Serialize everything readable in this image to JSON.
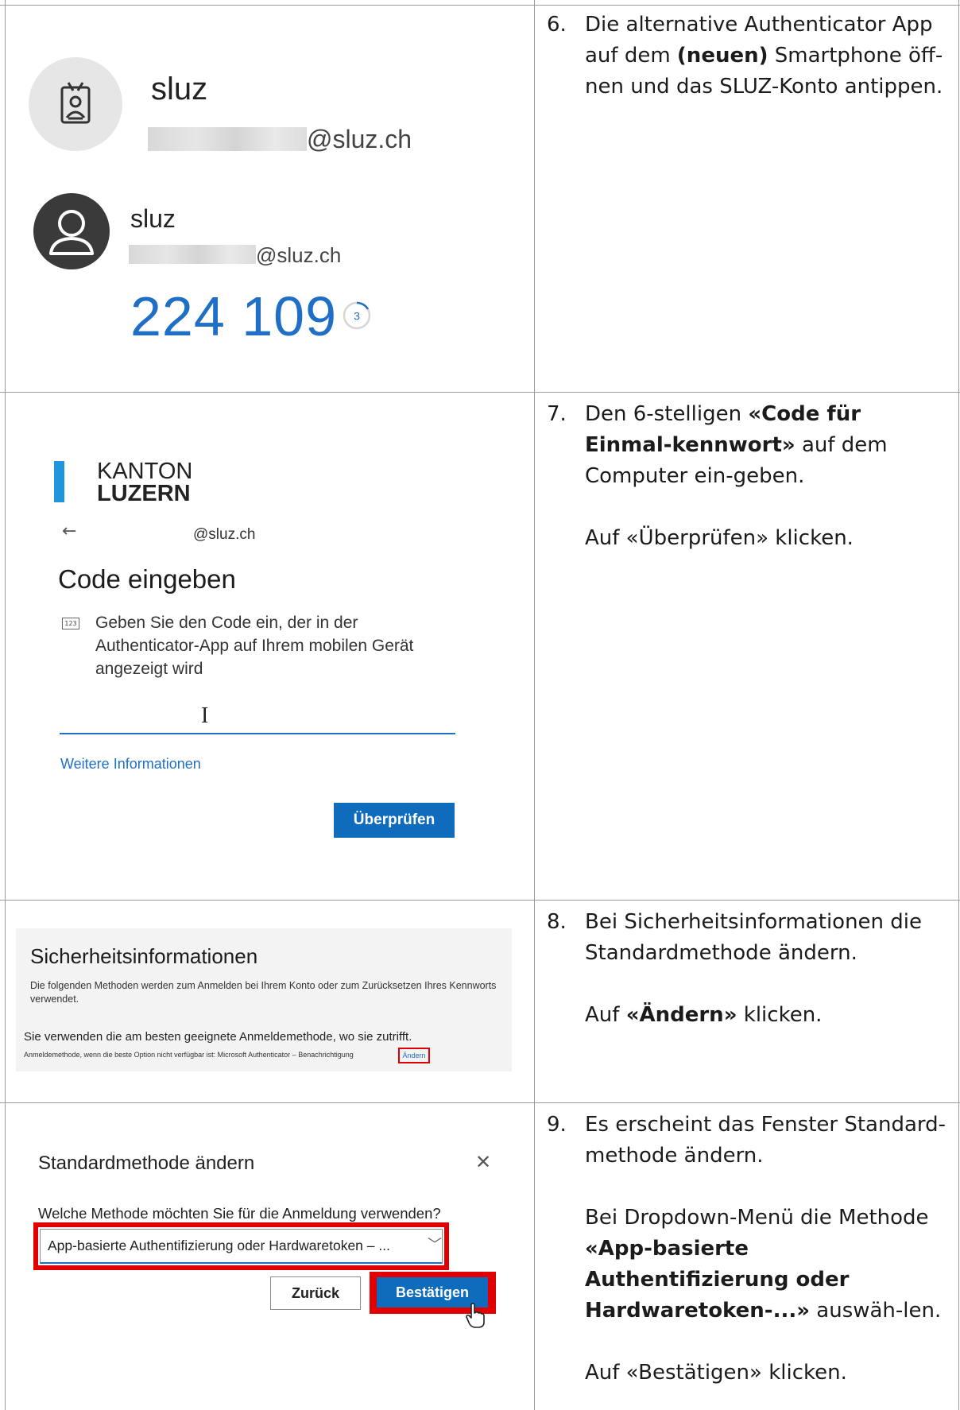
{
  "steps": [
    {
      "num": "6.",
      "lines": [
        {
          "parts": [
            {
              "t": "Die alternative Authenticator App auf dem ",
              "b": false
            },
            {
              "t": "(neuen)",
              "b": true
            },
            {
              "t": " Smartphone öff-nen und das SLUZ-Konto antippen.",
              "b": false
            }
          ]
        }
      ]
    },
    {
      "num": "7.",
      "lines": [
        {
          "parts": [
            {
              "t": "Den 6-stelligen ",
              "b": false
            },
            {
              "t": "«Code für Einmal-kennwort»",
              "b": true
            },
            {
              "t": " auf dem Computer ein-geben.",
              "b": false
            }
          ]
        },
        {
          "parts": [
            {
              "t": "Auf «Überprüfen» klicken.",
              "b": false
            }
          ]
        }
      ]
    },
    {
      "num": "8.",
      "lines": [
        {
          "parts": [
            {
              "t": "Bei Sicherheitsinformationen die Standardmethode ändern.",
              "b": false
            }
          ]
        },
        {
          "parts": [
            {
              "t": "Auf ",
              "b": false
            },
            {
              "t": "«Ändern»",
              "b": true
            },
            {
              "t": " klicken.",
              "b": false
            }
          ]
        }
      ]
    },
    {
      "num": "9.",
      "lines": [
        {
          "parts": [
            {
              "t": "Es erscheint das Fenster Standard-methode ändern.",
              "b": false
            }
          ]
        },
        {
          "parts": [
            {
              "t": "Bei Dropdown-Menü die Methode ",
              "b": false
            },
            {
              "t": "«App-basierte Authentifizierung oder Hardwaretoken-...»",
              "b": true
            },
            {
              "t": " auswäh-len.",
              "b": false
            }
          ]
        },
        {
          "parts": [
            {
              "t": "Auf «Bestätigen» klicken.",
              "b": false
            }
          ]
        }
      ]
    }
  ],
  "auth_app": {
    "account1": {
      "name": "sluz",
      "email_domain": "@sluz.ch"
    },
    "account2": {
      "name": "sluz",
      "email_domain": "@sluz.ch"
    },
    "otp_code": "224 109",
    "timer_seconds": "3",
    "accent_color": "#1f6fc7"
  },
  "code_page": {
    "logo_line1": "KANTON",
    "logo_line2": "LUZERN",
    "back_icon": "arrow-left-icon",
    "email": "@sluz.ch",
    "title": "Code eingeben",
    "keypad_icon_text": "123",
    "description": "Geben Sie den Code ein, der in der Authenticator-App auf Ihrem mobilen Gerät angezeigt wird",
    "more_info_link": "Weitere Informationen",
    "verify_button": "Überprüfen"
  },
  "security_info": {
    "title": "Sicherheitsinformationen",
    "description": "Die folgenden Methoden werden zum Anmelden bei Ihrem Konto oder zum Zurücksetzen Ihres Kennworts verwendet.",
    "note": "Sie verwenden die am besten geeignete Anmeldemethode, wo sie zutrifft.",
    "fallback_text": "Anmeldemethode, wenn die beste Option nicht verfügbar ist: Microsoft Authenticator – Benachrichtigung",
    "change_link": "Ändern"
  },
  "default_method": {
    "title": "Standardmethode ändern",
    "close_icon": "close-icon",
    "question": "Welche Methode möchten Sie für die Anmeldung verwenden?",
    "selected_option": "App-basierte Authentifizierung oder Hardwaretoken – ...",
    "back_button": "Zurück",
    "confirm_button": "Bestätigen"
  },
  "colors": {
    "highlight": "#e00000",
    "primary_button": "#0f6cbd",
    "logo_blue": "#1e95dd"
  }
}
